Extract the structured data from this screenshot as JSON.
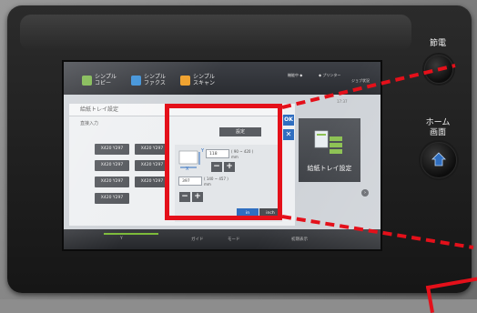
{
  "tabs": [
    {
      "label": "シンプル\nコピー",
      "icon": "copy-icon",
      "color": "#7ab648"
    },
    {
      "label": "シンプル\nファクス",
      "icon": "fax-icon",
      "color": "#3a8fd8"
    },
    {
      "label": "シンプル\nスキャン",
      "icon": "scan-icon",
      "color": "#f0a02a"
    }
  ],
  "status": {
    "left": "機能中 ◆",
    "printer": "◆ プリンター",
    "job": "ジョブ状況",
    "time": "17:37"
  },
  "dialog": {
    "title": "給紙トレイ設定",
    "subtitle": "直接入力",
    "ok_label": "OK",
    "close_label": "✕",
    "set_label": "設定"
  },
  "size_buttons": [
    "X420 Y297",
    "X420 Y297",
    "X420 Y297",
    "X420 Y297",
    "X420 Y297",
    "X420 Y297",
    "X420 Y297"
  ],
  "panel": {
    "y_value": "118",
    "y_range": "( 90 ~ 420 )",
    "y_unit": "mm",
    "x_value": "397",
    "x_range": "( 140 ~ 457 )",
    "x_unit": "mm",
    "minus_label": "−",
    "plus_label": "+",
    "axis_y": "Y",
    "axis_x": "X",
    "unit_mm": "in",
    "unit_inch": "inch"
  },
  "tray_card": {
    "label": "給紙トレイ設定"
  },
  "bottom": {
    "item1": "Y",
    "item2": "ガイド",
    "item3": "モード",
    "item4": "初期表示"
  },
  "hardware": {
    "power_save_label": "節電",
    "home_label": "ホーム\n画面"
  },
  "colors": {
    "accent_blue": "#2f6ec0",
    "annotation_red": "#e4101a"
  }
}
